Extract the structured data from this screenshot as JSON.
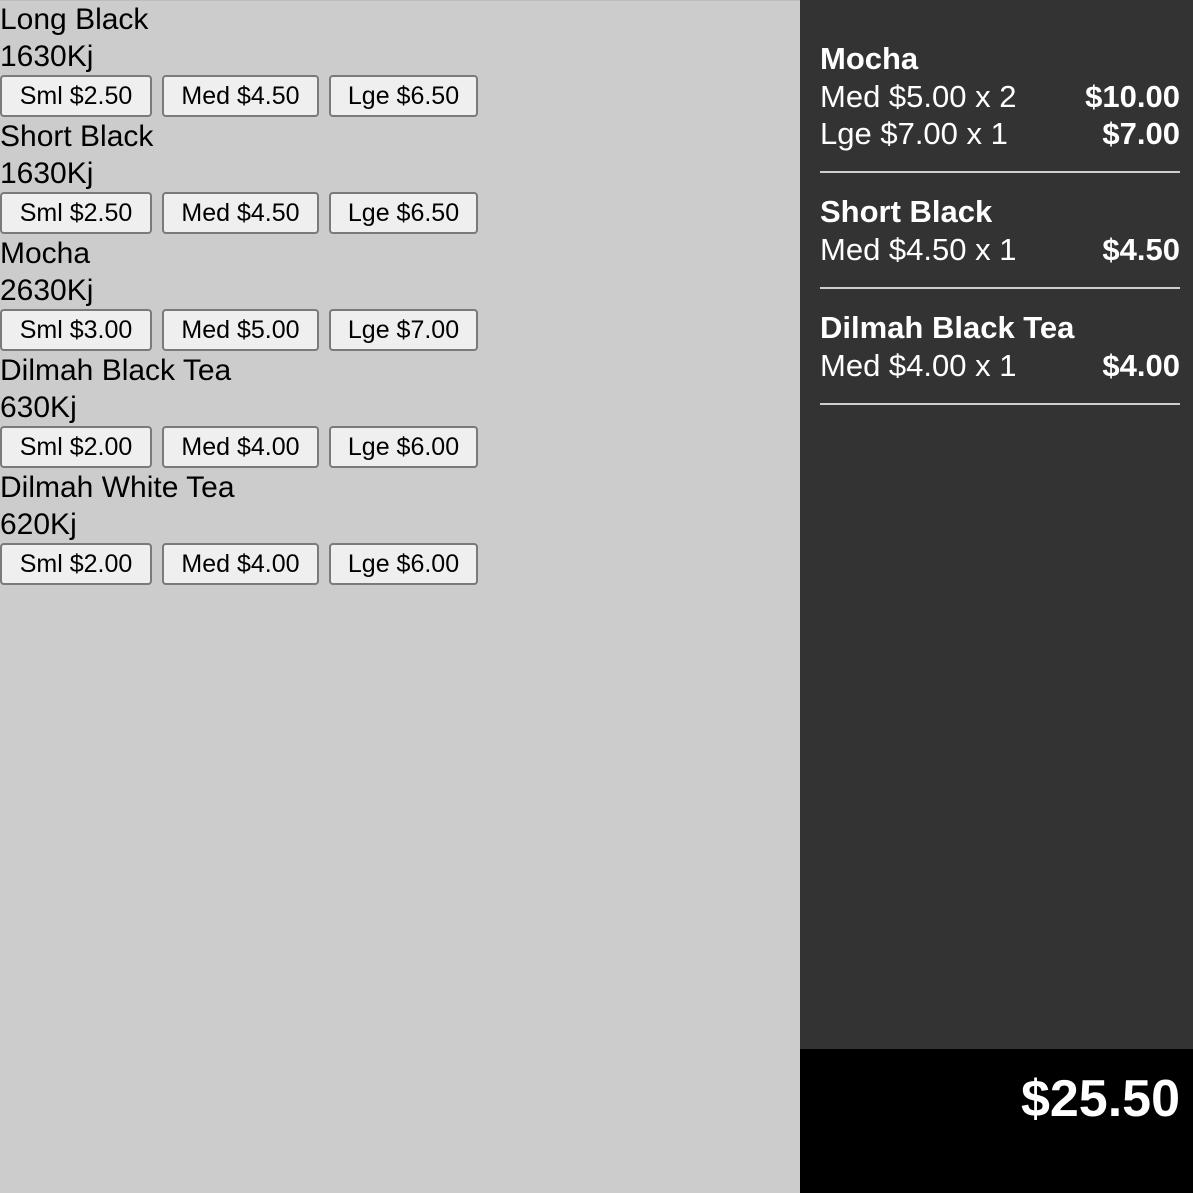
{
  "menu": {
    "items": [
      {
        "name": "Long Black",
        "energy": "1630Kj",
        "sizes": [
          "Sml $2.50",
          "Med $4.50",
          "Lge $6.50"
        ]
      },
      {
        "name": "Short Black",
        "energy": "1630Kj",
        "sizes": [
          "Sml $2.50",
          "Med $4.50",
          "Lge $6.50"
        ]
      },
      {
        "name": "Mocha",
        "energy": "2630Kj",
        "sizes": [
          "Sml $3.00",
          "Med $5.00",
          "Lge $7.00"
        ]
      },
      {
        "name": "Dilmah Black Tea",
        "energy": "630Kj",
        "sizes": [
          "Sml $2.00",
          "Med $4.00",
          "Lge $6.00"
        ]
      },
      {
        "name": "Dilmah White Tea",
        "energy": "620Kj",
        "sizes": [
          "Sml $2.00",
          "Med $4.00",
          "Lge $6.00"
        ]
      }
    ]
  },
  "order": {
    "groups": [
      {
        "name": "Mocha",
        "lines": [
          {
            "desc": "Med $5.00 x 2",
            "total": "$10.00"
          },
          {
            "desc": "Lge $7.00 x 1",
            "total": "$7.00"
          }
        ]
      },
      {
        "name": "Short Black",
        "lines": [
          {
            "desc": "Med $4.50 x 1",
            "total": "$4.50"
          }
        ]
      },
      {
        "name": "Dilmah Black Tea",
        "lines": [
          {
            "desc": "Med $4.00 x 1",
            "total": "$4.00"
          }
        ]
      }
    ],
    "grand_total": "$25.50"
  },
  "colors": {
    "menu_background": "#cccccc",
    "order_background": "#333333",
    "total_background": "#000000",
    "button_background": "#efefef"
  }
}
